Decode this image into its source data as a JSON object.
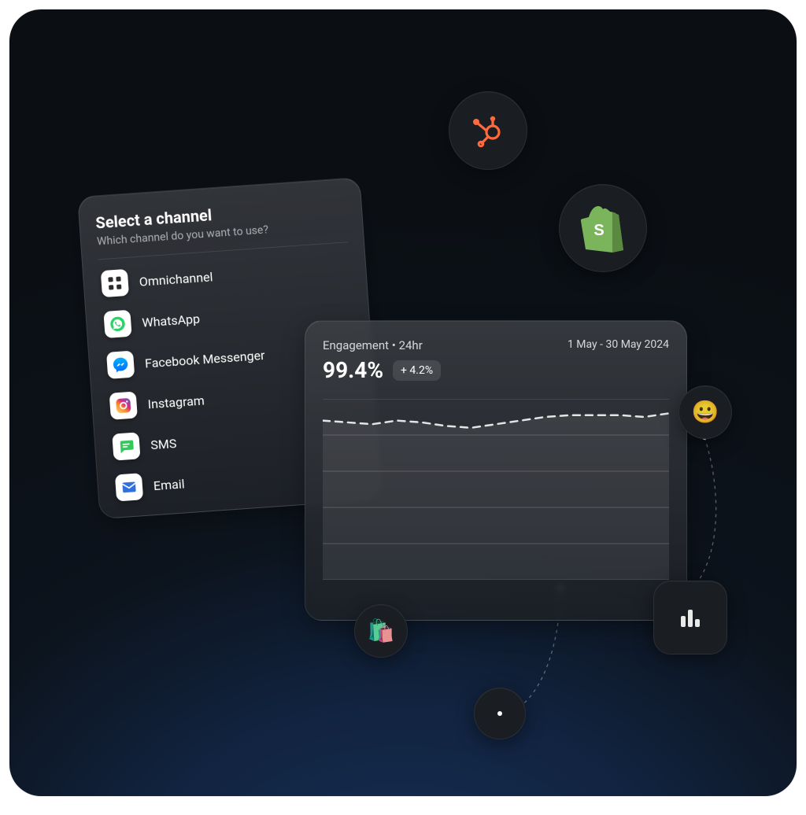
{
  "channel_card": {
    "title": "Select a channel",
    "subtitle": "Which channel do you want to use?",
    "items": [
      {
        "label": "Omnichannel",
        "icon": "grid-icon"
      },
      {
        "label": "WhatsApp",
        "icon": "whatsapp-icon"
      },
      {
        "label": "Facebook Messenger",
        "icon": "messenger-icon"
      },
      {
        "label": "Instagram",
        "icon": "instagram-icon"
      },
      {
        "label": "SMS",
        "icon": "sms-icon"
      },
      {
        "label": "Email",
        "icon": "email-icon"
      }
    ]
  },
  "engagement_card": {
    "title": "Engagement • 24hr",
    "date_range": "1 May - 30 May 2024",
    "value": "99.4%",
    "delta": "+ 4.2%"
  },
  "integration_bubbles": {
    "hubspot": {
      "name": "hubspot-icon",
      "color": "#ff6a3d"
    },
    "shopify": {
      "name": "shopify-icon",
      "color": "#7ab55c"
    },
    "emoji": {
      "name": "smile-emoji",
      "glyph": "😀"
    },
    "bags": {
      "name": "shopping-bags",
      "glyph": "🛍️"
    },
    "barchart": {
      "name": "bar-chart-icon"
    },
    "dot": {
      "name": "node-dot"
    }
  },
  "chart_data": {
    "type": "area",
    "title": "Engagement • 24hr",
    "xlabel": "",
    "ylabel": "",
    "ylim": [
      0,
      100
    ],
    "x": [
      0,
      1,
      2,
      3,
      4,
      5,
      6,
      7,
      8,
      9,
      10,
      11,
      12,
      13,
      14
    ],
    "series": [
      {
        "name": "Engagement",
        "values": [
          88,
          87,
          86,
          88,
          87,
          85,
          84,
          86,
          88,
          90,
          91,
          91,
          91,
          90,
          92
        ]
      }
    ],
    "gridlines_y": [
      0,
      20,
      40,
      60,
      80,
      100
    ]
  }
}
